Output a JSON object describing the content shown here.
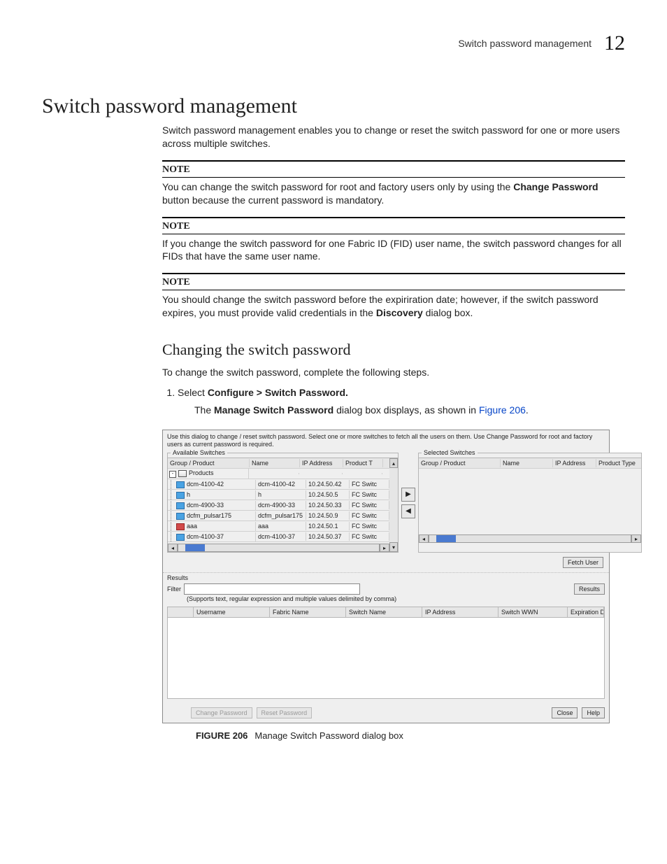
{
  "header": {
    "section": "Switch password management",
    "chapter_number": "12"
  },
  "title": "Switch password management",
  "intro": "Switch password management enables you to change or reset the switch password for one or more users across multiple switches.",
  "notes": [
    {
      "label": "NOTE",
      "text_pre": "You can change the switch password for root and factory users only by using the ",
      "bold": "Change Password",
      "text_post": " button because the current password is mandatory."
    },
    {
      "label": "NOTE",
      "text": "If you change the switch password for one Fabric ID (FID) user name, the switch password changes for all FIDs that have the same user name."
    },
    {
      "label": "NOTE",
      "text_pre": "You should change the switch password before the expiriration date; however, if the switch password expires, you must provide valid credentials in the ",
      "bold": "Discovery",
      "text_post": " dialog box."
    }
  ],
  "subtitle": "Changing the switch password",
  "sub_intro": "To change the switch password, complete the following steps.",
  "step1": {
    "pre": "Select ",
    "bold": "Configure > Switch Password."
  },
  "step1_sub": {
    "pre": "The ",
    "bold": "Manage Switch Password",
    "mid": " dialog box displays, as shown in ",
    "link": "Figure 206",
    "post": "."
  },
  "dialog": {
    "desc": "Use this dialog to change / reset switch password. Select one or more switches to fetch all the users on them. Use Change Password for root and factory users as current password is required.",
    "available_title": "Available Switches",
    "selected_title": "Selected Switches",
    "columns": {
      "group_product": "Group / Product",
      "name": "Name",
      "ip": "IP Address",
      "ptype": "Product T",
      "ptype_full": "Product Type"
    },
    "rows": [
      {
        "label": "Products",
        "name": "",
        "ip": "",
        "type": "",
        "top": true
      },
      {
        "label": "dcm-4100-42",
        "name": "dcm-4100-42",
        "ip": "10.24.50.42",
        "type": "FC Switc",
        "color": "blue"
      },
      {
        "label": "h",
        "name": "h",
        "ip": "10.24.50.5",
        "type": "FC Switc",
        "color": "blue"
      },
      {
        "label": "dcm-4900-33",
        "name": "dcm-4900-33",
        "ip": "10.24.50.33",
        "type": "FC Switc",
        "color": "blue"
      },
      {
        "label": "dcfm_pulsar175",
        "name": "dcfm_pulsar175",
        "ip": "10.24.50.9",
        "type": "FC Switc",
        "color": "blue"
      },
      {
        "label": "aaa",
        "name": "aaa",
        "ip": "10.24.50.1",
        "type": "FC Switc",
        "color": "red"
      },
      {
        "label": "dcm-4100-37",
        "name": "dcm-4100-37",
        "ip": "10.24.50.37",
        "type": "FC Switc",
        "color": "blue"
      }
    ],
    "transfer_add": "▶",
    "transfer_remove": "◀",
    "fetch_user": "Fetch User",
    "results_title": "Results",
    "filter_label": "Filter",
    "filter_button": "Results",
    "filter_hint": "(Supports text, regular expression and multiple values delimited by comma)",
    "results_columns": {
      "blank": "",
      "username": "Username",
      "fabric_name": "Fabric Name",
      "switch_name": "Switch Name",
      "ip": "IP Address",
      "switch_wwn": "Switch WWN",
      "expiration": "Expiration Date"
    },
    "change_pw": "Change Password",
    "reset_pw": "Reset Password",
    "close": "Close",
    "help": "Help"
  },
  "figure": {
    "number": "FIGURE 206",
    "caption": "Manage Switch Password dialog box"
  }
}
